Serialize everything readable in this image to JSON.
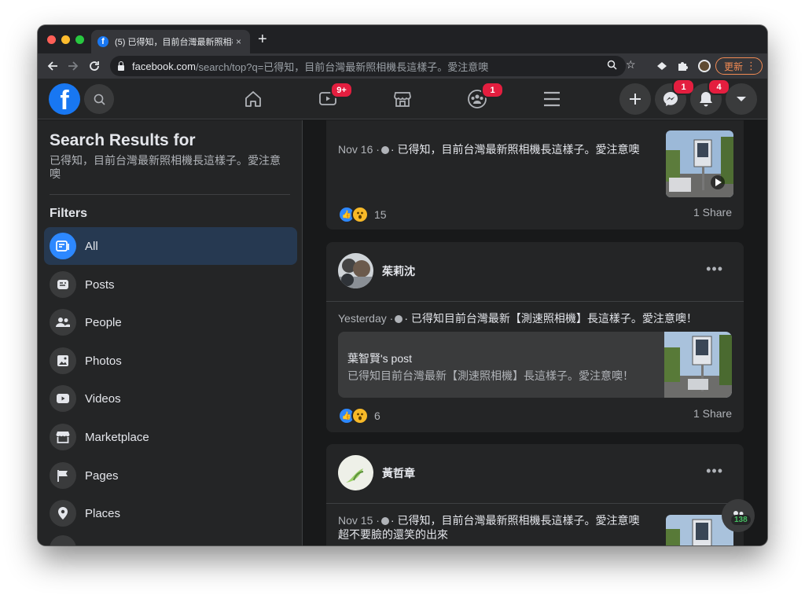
{
  "browser": {
    "tab_title": "(5) 已得知，目前台灣最新照相機",
    "tab_close": "×",
    "new_tab": "+",
    "url_host": "facebook.com",
    "url_path": "/search/top?q=已得知，目前台灣最新照相機長這樣子。愛注意噢",
    "update_label": "更新",
    "menu_dots": "⋮"
  },
  "header": {
    "logo_letter": "f",
    "watch_badge": "9+",
    "groups_badge": "1",
    "messenger_badge": "1",
    "notifications_badge": "4"
  },
  "sidebar": {
    "title": "Search Results for",
    "query": "已得知，目前台灣最新照相機長這樣子。愛注意噢",
    "filters_heading": "Filters",
    "items": [
      {
        "label": "All",
        "icon": "all-icon"
      },
      {
        "label": "Posts",
        "icon": "posts-icon"
      },
      {
        "label": "People",
        "icon": "people-icon"
      },
      {
        "label": "Photos",
        "icon": "photos-icon"
      },
      {
        "label": "Videos",
        "icon": "videos-icon"
      },
      {
        "label": "Marketplace",
        "icon": "marketplace-icon"
      },
      {
        "label": "Pages",
        "icon": "pages-icon"
      },
      {
        "label": "Places",
        "icon": "places-icon"
      }
    ]
  },
  "posts": [
    {
      "date": "Nov 16 ·",
      "text": "· 已得知，目前台灣最新照相機長這樣子。愛注意噢",
      "reaction_count": "15",
      "shares": "1 Share"
    },
    {
      "author": "茱莉沈",
      "date": "Yesterday ·",
      "text": "· 已得知目前台灣最新【測速照相機】長這樣子。愛注意噢！",
      "shared_author": "葉智賢's post",
      "shared_text": "已得知目前台灣最新【測速照相機】長這樣子。愛注意噢！",
      "reaction_count": "6",
      "shares": "1 Share"
    },
    {
      "author": "黃哲章",
      "date": "Nov 15 ·",
      "text": "· 已得知，目前台灣最新照相機長這樣子。愛注意噢",
      "text_line2": "超不要臉的還笑的出來"
    }
  ],
  "chat": {
    "count": "138"
  },
  "colors": {
    "accent": "#1877f2",
    "badge": "#e41e3f",
    "background": "#18191a",
    "surface": "#242526"
  }
}
